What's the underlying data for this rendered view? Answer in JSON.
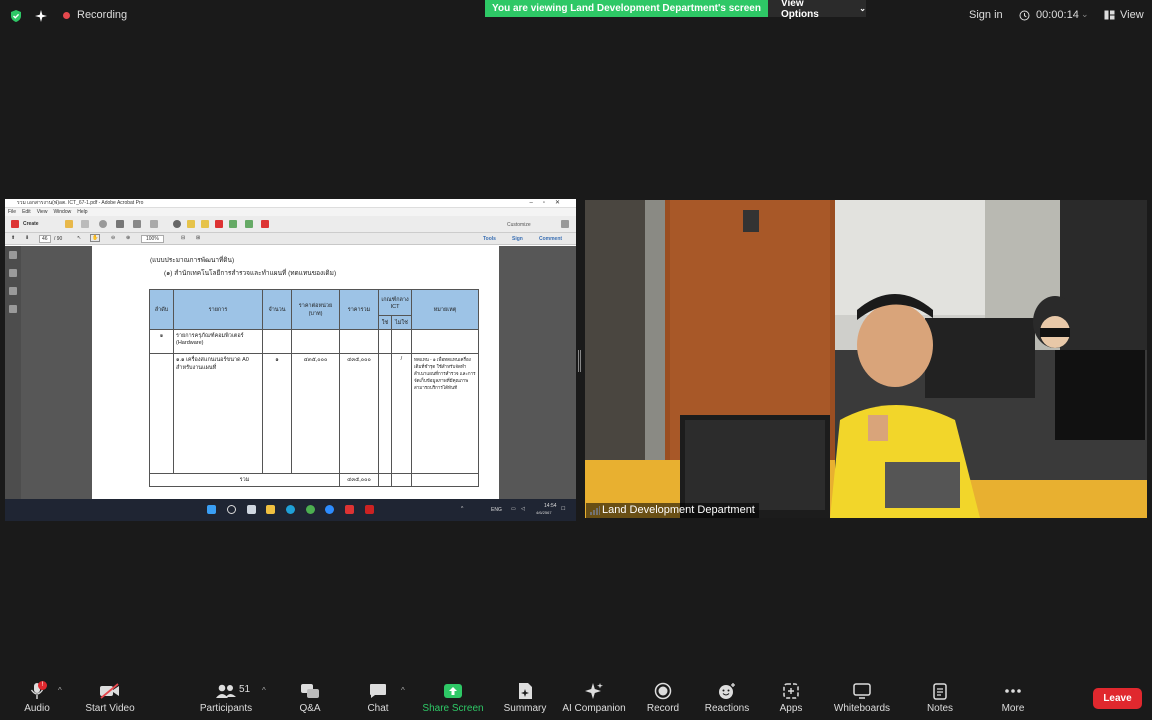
{
  "top_bar": {
    "recording_label": "Recording",
    "banner_text": "You are viewing Land Development Department's screen",
    "view_options_label": "View Options",
    "sign_in_label": "Sign in",
    "timer": "00:00:14",
    "view_label": "View"
  },
  "shared_screen": {
    "window_title": "รวม เอกสารงาน(ฟ)อต. ICT_67-1.pdf - Adobe Acrobat Pro",
    "menu": [
      "File",
      "Edit",
      "View",
      "Window",
      "Help"
    ],
    "create_label": "Create",
    "customize_label": "Customize",
    "page_current": "46",
    "page_total": "/ 90",
    "zoom": "100%",
    "tools_label": "Tools",
    "sign_label": "Sign",
    "comment_label": "Comment",
    "document": {
      "heading_line1": "(แบบประมาณการพัฒนาที่ดิน)",
      "heading_line2": "(๑) สำนักเทคโนโลยีการสำรวจและทำแผนที่ (ทดแทนของเดิม)",
      "headers": [
        "ลำดับ",
        "รายการ",
        "จำนวน",
        "ราคาต่อหน่วย (บาท)",
        "ราคารวม",
        "เกณฑ์กลาง ICT",
        "หมายเหตุ"
      ],
      "subheaders": [
        "ใช่",
        "ไม่ใช่"
      ],
      "row1": {
        "no": "๑",
        "item": "รายการครุภัณฑ์คอมพิวเตอร์ (Hardware)"
      },
      "row2": {
        "item": "๑.๑ เครื่องสแกนเนอร์ขนาด A0 สำหรับงานแผนที่",
        "qty": "๑",
        "unit_price": "๔๓๕,๐๐๐",
        "total": "๔๓๕,๐๐๐",
        "mark": "/",
        "note": "ทดแทน - ๑ เพื่อทดแทนเครื่องเดิมที่ชำรุด ใช้สำหรับจัดทำสำเนาแผนที่การสำรวจ และการจัดเก็บข้อมูลภาพที่มีคุณภาพ สามารถบริการได้ทันที"
      },
      "total_label": "รวม",
      "total_value": "๔๓๕,๐๐๐"
    },
    "taskbar": {
      "lang": "ENG",
      "time": "14:54",
      "date": "4/6/2567"
    }
  },
  "video": {
    "participant_name": "Land Development Department"
  },
  "toolbar": {
    "audio_label": "Audio",
    "audio_badge": "!",
    "start_video_label": "Start Video",
    "participants_label": "Participants",
    "participants_count": "51",
    "qa_label": "Q&A",
    "chat_label": "Chat",
    "share_screen_label": "Share Screen",
    "summary_label": "Summary",
    "ai_companion_label": "AI Companion",
    "record_label": "Record",
    "reactions_label": "Reactions",
    "apps_label": "Apps",
    "whiteboards_label": "Whiteboards",
    "notes_label": "Notes",
    "more_label": "More",
    "leave_label": "Leave"
  },
  "colors": {
    "background": "#1a1a1a",
    "banner_green": "#2ec866",
    "share_green": "#2ec866",
    "leave_red": "#e0282e",
    "table_header_blue": "#9dc3e6"
  }
}
